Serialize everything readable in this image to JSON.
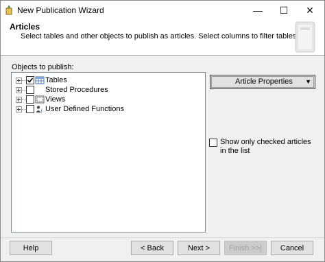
{
  "window": {
    "title": "New Publication Wizard",
    "controls": {
      "minimize": "—",
      "maximize": "☐",
      "close": "✕"
    }
  },
  "header": {
    "title": "Articles",
    "subtitle": "Select tables and other objects to publish as articles. Select columns to filter tables."
  },
  "tree": {
    "label": "Objects to publish:",
    "nodes": [
      {
        "label": "Tables",
        "checked": true,
        "icon": "table-icon"
      },
      {
        "label": "Stored Procedures",
        "checked": false,
        "icon": "stored-procedure-icon"
      },
      {
        "label": "Views",
        "checked": false,
        "icon": "view-icon"
      },
      {
        "label": "User Defined Functions",
        "checked": false,
        "icon": "function-icon"
      }
    ]
  },
  "article_properties": {
    "label": "Article Properties",
    "arrow": "▼"
  },
  "show_only_checked": {
    "label": "Show only checked articles in the list",
    "checked": false
  },
  "buttons": {
    "help": "Help",
    "back": "< Back",
    "next": "Next >",
    "finish": "Finish >>|",
    "cancel": "Cancel"
  }
}
